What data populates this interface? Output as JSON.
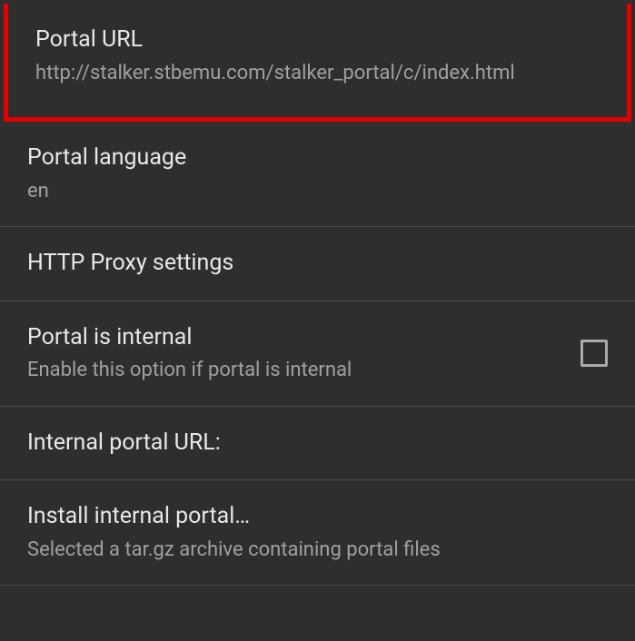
{
  "settings": [
    {
      "title": "Portal URL",
      "subtitle": "http://stalker.stbemu.com/stalker_portal/c/index.html",
      "highlight": true,
      "checkbox": false
    },
    {
      "title": "Portal language",
      "subtitle": "en",
      "highlight": false,
      "checkbox": false
    },
    {
      "title": "HTTP Proxy settings",
      "subtitle": null,
      "highlight": false,
      "checkbox": false
    },
    {
      "title": "Portal is internal",
      "subtitle": "Enable this option if portal is internal",
      "highlight": false,
      "checkbox": true
    },
    {
      "title": "Internal portal URL:",
      "subtitle": null,
      "highlight": false,
      "checkbox": false
    },
    {
      "title": "Install internal portal…",
      "subtitle": "Selected a tar.gz archive containing portal files",
      "highlight": false,
      "checkbox": false
    }
  ]
}
